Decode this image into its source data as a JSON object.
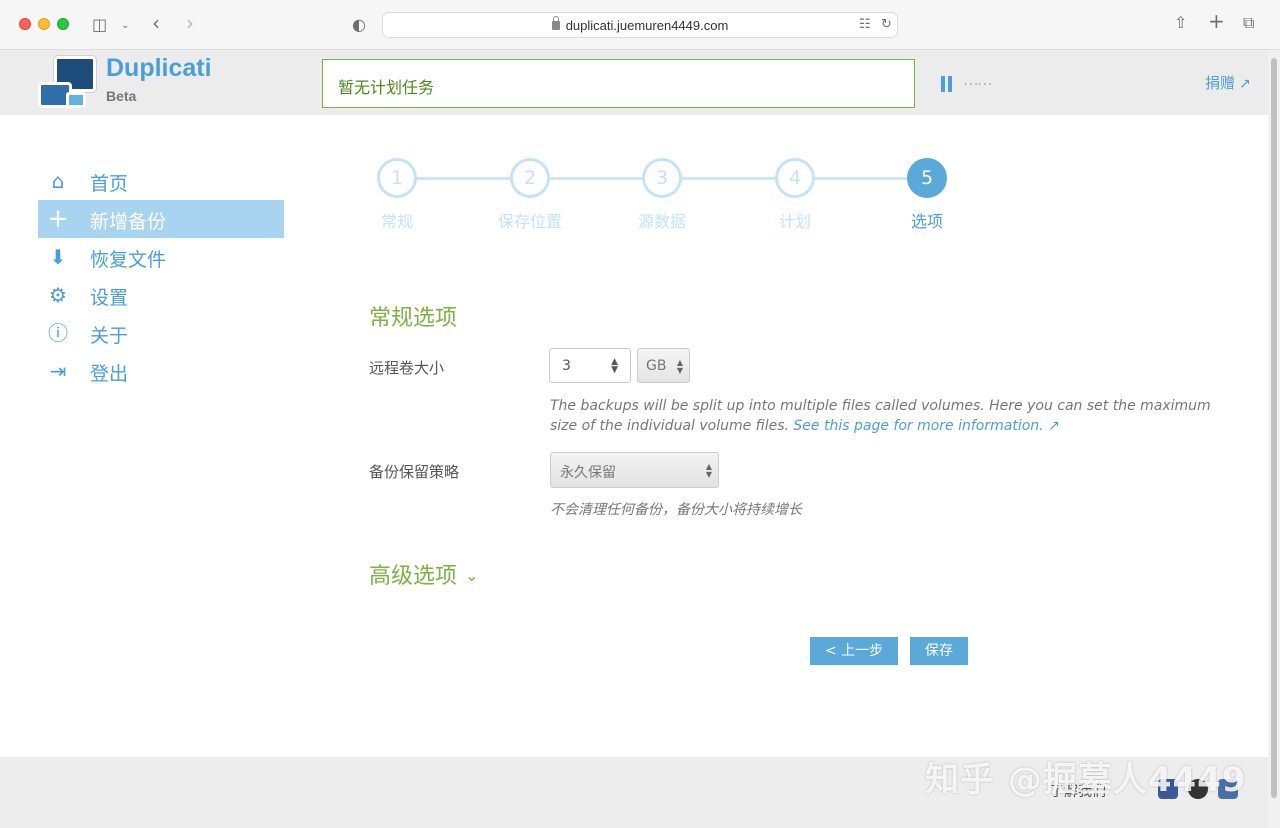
{
  "browser": {
    "url": "duplicati.juemuren4449.com"
  },
  "header": {
    "brand": "Duplicati",
    "brand_sub": "Beta",
    "status": "暂无计划任务",
    "donate": "捐赠"
  },
  "sidebar": {
    "items": [
      {
        "label": "首页",
        "icon": "home-icon"
      },
      {
        "label": "新增备份",
        "icon": "plus-icon"
      },
      {
        "label": "恢复文件",
        "icon": "restore-icon"
      },
      {
        "label": "设置",
        "icon": "gear-icon"
      },
      {
        "label": "关于",
        "icon": "info-icon"
      },
      {
        "label": "登出",
        "icon": "logout-icon"
      }
    ],
    "active_index": 1
  },
  "steps": [
    {
      "num": "1",
      "label": "常规"
    },
    {
      "num": "2",
      "label": "保存位置"
    },
    {
      "num": "3",
      "label": "源数据"
    },
    {
      "num": "4",
      "label": "计划"
    },
    {
      "num": "5",
      "label": "选项"
    }
  ],
  "form": {
    "general_title": "常规选项",
    "volume_label": "远程卷大小",
    "volume_value": "3",
    "volume_unit": "GB",
    "volume_help": "The backups will be split up into multiple files called volumes. Here you can set the maximum size of the individual volume files.",
    "volume_help_link": "See this page for more information.",
    "retention_label": "备份保留策略",
    "retention_value": "永久保留",
    "retention_help": "不会清理任何备份，备份大小将持续增长",
    "advanced_title": "高级选项"
  },
  "buttons": {
    "prev": "< 上一步",
    "save": "保存"
  },
  "footer": {
    "text": "了解我们",
    "watermark": "知乎 @掘墓人4449"
  }
}
